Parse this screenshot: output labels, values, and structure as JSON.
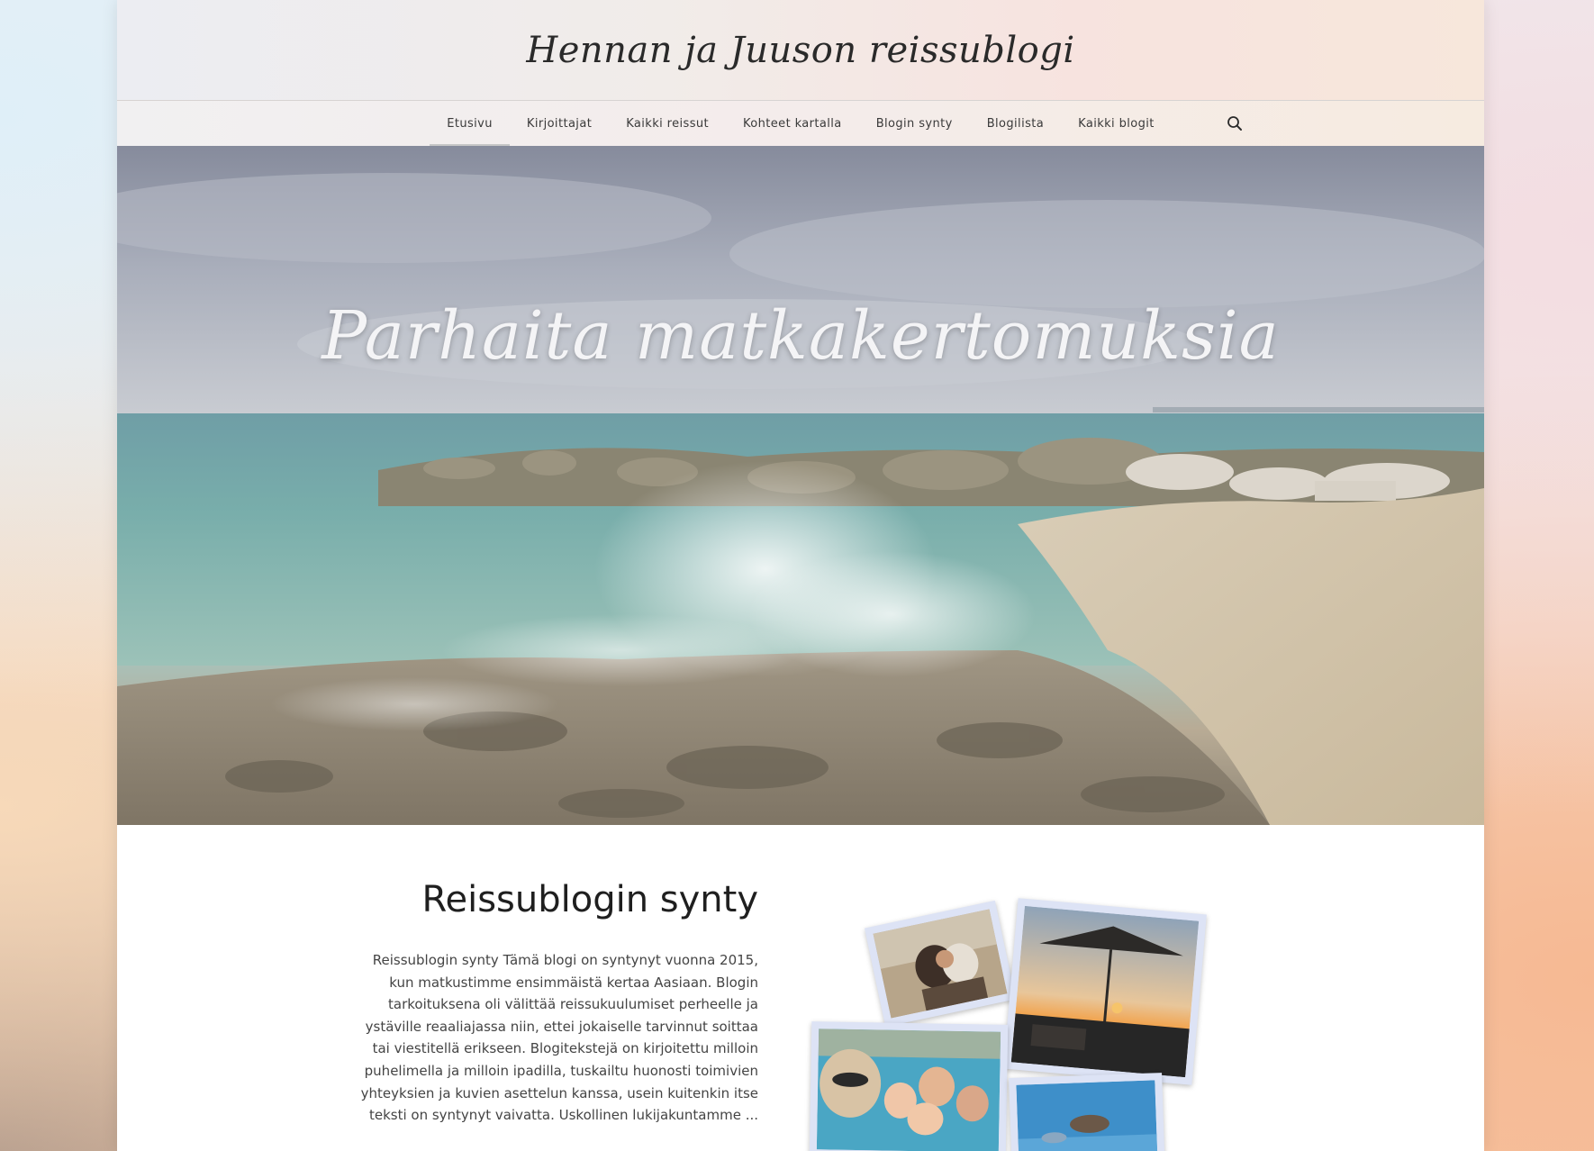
{
  "site": {
    "title": "Hennan ja Juuson reissublogi"
  },
  "nav": {
    "items": [
      {
        "label": "Etusivu",
        "active": true
      },
      {
        "label": "Kirjoittajat"
      },
      {
        "label": "Kaikki reissut"
      },
      {
        "label": "Kohteet kartalla"
      },
      {
        "label": "Blogin synty"
      },
      {
        "label": "Blogilista"
      },
      {
        "label": "Kaikki blogit"
      }
    ],
    "search_icon": "search-icon"
  },
  "hero": {
    "title": "Parhaita matkakertomuksia",
    "image": "beach-waves-rocks"
  },
  "section": {
    "title": "Reissublogin synty",
    "body": "Reissublogin synty Tämä blogi on syntynyt vuonna 2015, kun matkustimme ensimmäistä kertaa Aasiaan. Blogin tarkoituksena oli välittää reissukuulumiset perheelle ja ystäville reaaliajassa niin, ettei jokaiselle tarvinnut soittaa tai viestitellä erikseen. Blogitekstejä on kirjoitettu milloin puhelimella ja milloin ipadilla, tuskailtu huonosti toimivien yhteyksien ja kuvien asettelun kanssa, usein kuitenkin itse teksti on syntynyt vaivatta. Uskollinen lukijakuntamme ..."
  },
  "photos": [
    {
      "subject": "couple-on-rocks"
    },
    {
      "subject": "sunset-umbrella-beach"
    },
    {
      "subject": "family-in-pool"
    },
    {
      "subject": "underwater-snorkeling"
    }
  ]
}
